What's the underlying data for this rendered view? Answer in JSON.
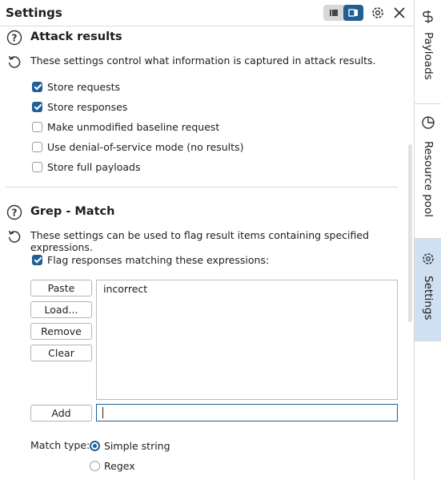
{
  "header": {
    "title": "Settings"
  },
  "attack_results": {
    "title": "Attack results",
    "description": "These settings control what information is captured in attack results.",
    "options": [
      {
        "label": "Store requests",
        "checked": true
      },
      {
        "label": "Store responses",
        "checked": true
      },
      {
        "label": "Make unmodified baseline request",
        "checked": false
      },
      {
        "label": "Use denial-of-service mode (no results)",
        "checked": false
      },
      {
        "label": "Store full payloads",
        "checked": false
      }
    ]
  },
  "grep_match": {
    "title": "Grep - Match",
    "description": "These settings can be used to flag result items containing specified expressions.",
    "flag_label": "Flag responses matching these expressions:",
    "flag_checked": true,
    "buttons": {
      "paste": "Paste",
      "load": "Load...",
      "remove": "Remove",
      "clear": "Clear",
      "add": "Add"
    },
    "items": [
      "incorrect"
    ],
    "input_value": "",
    "match_type_label": "Match type:",
    "match_types": [
      {
        "label": "Simple string",
        "selected": true
      },
      {
        "label": "Regex",
        "selected": false
      }
    ]
  },
  "side_tabs": [
    {
      "label": "Payloads",
      "icon": "payloads-icon",
      "active": false
    },
    {
      "label": "Resource pool",
      "icon": "resource-pool-icon",
      "active": false
    },
    {
      "label": "Settings",
      "icon": "gear-icon",
      "active": true
    }
  ],
  "colors": {
    "accent": "#1f5f96",
    "active_tab": "#cfe0f2"
  }
}
